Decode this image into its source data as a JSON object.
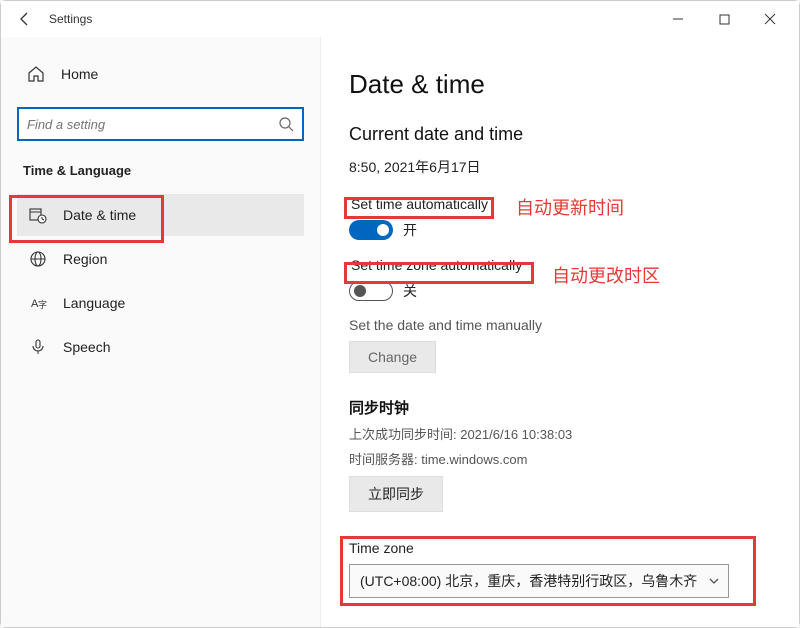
{
  "window": {
    "title": "Settings"
  },
  "sidebar": {
    "home": "Home",
    "search_placeholder": "Find a setting",
    "category": "Time & Language",
    "items": [
      {
        "label": "Date & time"
      },
      {
        "label": "Region"
      },
      {
        "label": "Language"
      },
      {
        "label": "Speech"
      }
    ]
  },
  "content": {
    "title": "Date & time",
    "current_heading": "Current date and time",
    "current_value": "8:50, 2021年6月17日",
    "auto_time_label": "Set time automatically",
    "auto_time_state": "开",
    "auto_tz_label": "Set time zone automatically",
    "auto_tz_state": "关",
    "manual_label": "Set the date and time manually",
    "change_btn": "Change",
    "sync_title": "同步时钟",
    "sync_last": "上次成功同步时间: 2021/6/16 10:38:03",
    "sync_server": "时间服务器: time.windows.com",
    "sync_btn": "立即同步",
    "tz_label": "Time zone",
    "tz_value": "(UTC+08:00) 北京，重庆，香港特别行政区，乌鲁木齐"
  },
  "annotations": {
    "a1": "自动更新时间",
    "a2": "自动更改时区"
  }
}
